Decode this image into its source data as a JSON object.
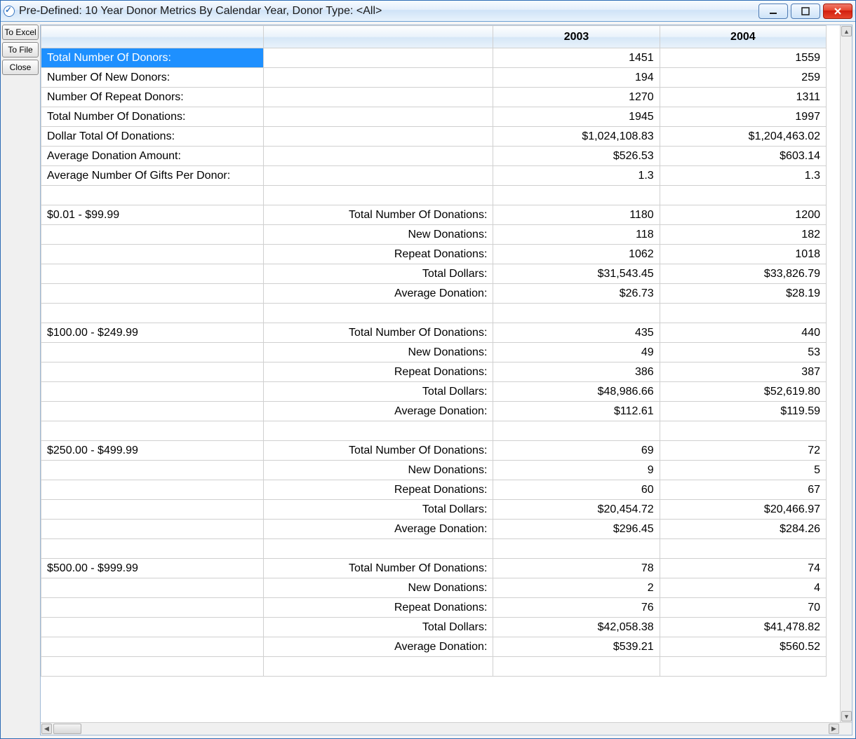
{
  "window": {
    "title": "Pre-Defined: 10 Year Donor Metrics By Calendar Year, Donor Type: <All>"
  },
  "side_buttons": {
    "to_excel": "To Excel",
    "to_file": "To File",
    "close": "Close"
  },
  "columns": {
    "col0": "",
    "col1": "",
    "col2": "2003",
    "col3": "2004"
  },
  "summary": [
    {
      "label": "Total Number Of Donors:",
      "y2003": "1451",
      "y2004": "1559",
      "selected": true
    },
    {
      "label": "Number Of New Donors:",
      "y2003": "194",
      "y2004": "259"
    },
    {
      "label": "Number Of Repeat Donors:",
      "y2003": "1270",
      "y2004": "1311"
    },
    {
      "label": "Total Number Of Donations:",
      "y2003": "1945",
      "y2004": "1997"
    },
    {
      "label": "Dollar Total Of Donations:",
      "y2003": "$1,024,108.83",
      "y2004": "$1,204,463.02"
    },
    {
      "label": "Average Donation Amount:",
      "y2003": "$526.53",
      "y2004": "$603.14"
    },
    {
      "label": "Average Number Of Gifts Per Donor:",
      "y2003": "1.3",
      "y2004": "1.3"
    }
  ],
  "ranges": [
    {
      "range": "$0.01 - $99.99",
      "rows": [
        {
          "sub": "Total Number Of Donations:",
          "y2003": "1180",
          "y2004": "1200"
        },
        {
          "sub": "New Donations:",
          "y2003": "118",
          "y2004": "182"
        },
        {
          "sub": "Repeat Donations:",
          "y2003": "1062",
          "y2004": "1018"
        },
        {
          "sub": "Total Dollars:",
          "y2003": "$31,543.45",
          "y2004": "$33,826.79"
        },
        {
          "sub": "Average Donation:",
          "y2003": "$26.73",
          "y2004": "$28.19"
        }
      ]
    },
    {
      "range": "$100.00 - $249.99",
      "rows": [
        {
          "sub": "Total Number Of Donations:",
          "y2003": "435",
          "y2004": "440"
        },
        {
          "sub": "New Donations:",
          "y2003": "49",
          "y2004": "53"
        },
        {
          "sub": "Repeat Donations:",
          "y2003": "386",
          "y2004": "387"
        },
        {
          "sub": "Total Dollars:",
          "y2003": "$48,986.66",
          "y2004": "$52,619.80"
        },
        {
          "sub": "Average Donation:",
          "y2003": "$112.61",
          "y2004": "$119.59"
        }
      ]
    },
    {
      "range": "$250.00 - $499.99",
      "rows": [
        {
          "sub": "Total Number Of Donations:",
          "y2003": "69",
          "y2004": "72"
        },
        {
          "sub": "New Donations:",
          "y2003": "9",
          "y2004": "5"
        },
        {
          "sub": "Repeat Donations:",
          "y2003": "60",
          "y2004": "67"
        },
        {
          "sub": "Total Dollars:",
          "y2003": "$20,454.72",
          "y2004": "$20,466.97"
        },
        {
          "sub": "Average Donation:",
          "y2003": "$296.45",
          "y2004": "$284.26"
        }
      ]
    },
    {
      "range": "$500.00 - $999.99",
      "rows": [
        {
          "sub": "Total Number Of Donations:",
          "y2003": "78",
          "y2004": "74"
        },
        {
          "sub": "New Donations:",
          "y2003": "2",
          "y2004": "4"
        },
        {
          "sub": "Repeat Donations:",
          "y2003": "76",
          "y2004": "70"
        },
        {
          "sub": "Total Dollars:",
          "y2003": "$42,058.38",
          "y2004": "$41,478.82"
        },
        {
          "sub": "Average Donation:",
          "y2003": "$539.21",
          "y2004": "$560.52"
        }
      ]
    }
  ]
}
